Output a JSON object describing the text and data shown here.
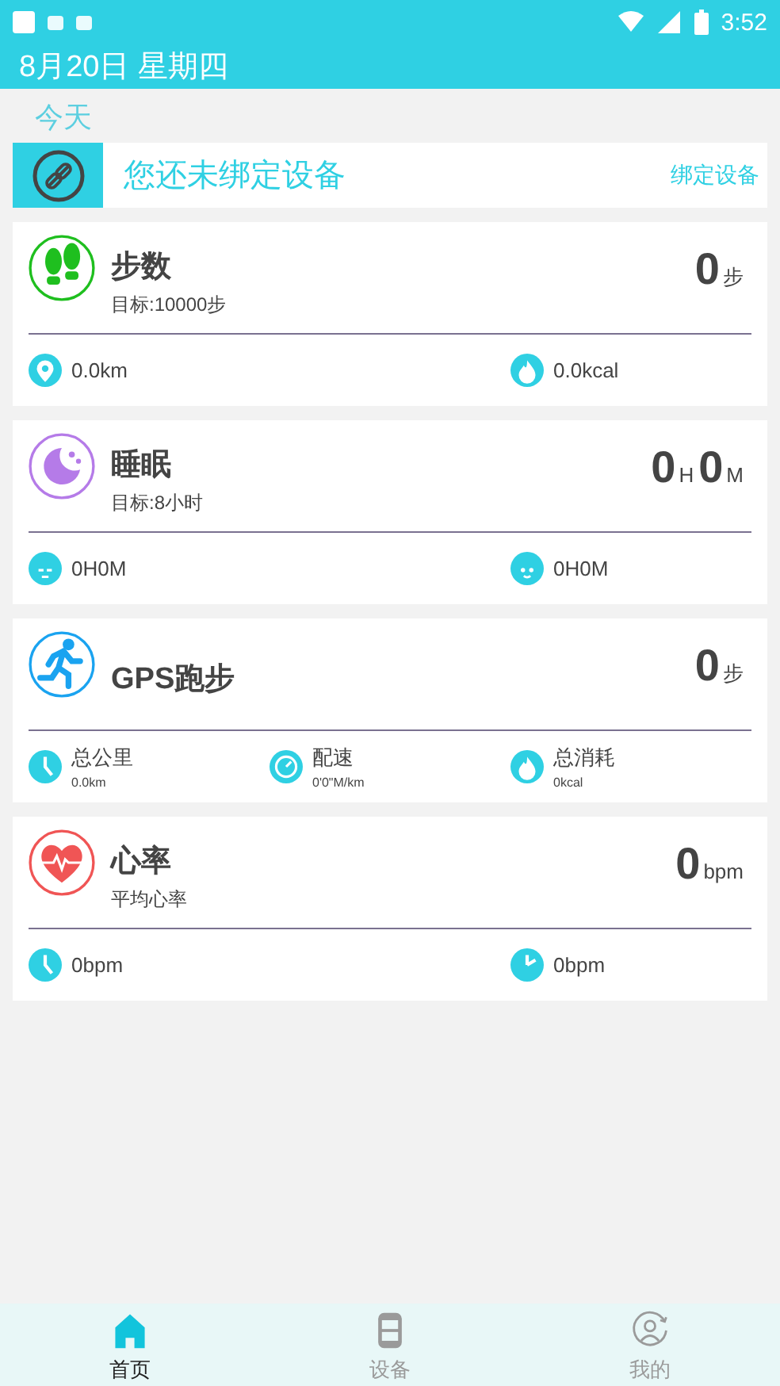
{
  "status_bar": {
    "time": "3:52"
  },
  "header": {
    "title": "8月20日 星期四"
  },
  "section_label": "今天",
  "bind_banner": {
    "message": "您还未绑定设备",
    "action": "绑定设备"
  },
  "cards": [
    {
      "kind": "steps",
      "color": "#1fbf1f",
      "title": "步数",
      "subtitle": "目标:10000步",
      "value": [
        {
          "kind": "number",
          "text": "0"
        },
        {
          "kind": "unit",
          "text": "步"
        }
      ],
      "stats": [
        {
          "kind": "pin",
          "value": "0.0km"
        },
        {
          "kind": "flame",
          "value": "0.0kcal"
        }
      ]
    },
    {
      "kind": "sleep",
      "color": "#b57be8",
      "title": "睡眠",
      "subtitle": "目标:8小时",
      "value": [
        {
          "kind": "number",
          "text": "0"
        },
        {
          "kind": "unit",
          "text": "H"
        },
        {
          "kind": "number",
          "text": "0"
        },
        {
          "kind": "unit",
          "text": "M"
        }
      ],
      "stats": [
        {
          "kind": "sleepy-face",
          "value": "0H0M"
        },
        {
          "kind": "face",
          "value": "0H0M"
        }
      ]
    },
    {
      "kind": "run",
      "color": "#1aa3f0",
      "title": "GPS跑步",
      "value": [
        {
          "kind": "number",
          "text": "0"
        },
        {
          "kind": "unit",
          "text": "步"
        }
      ],
      "stats": [
        {
          "kind": "clock",
          "label": "总公里",
          "value": "0.0km"
        },
        {
          "kind": "gauge",
          "label": "配速",
          "value": "0'0\"M/km"
        },
        {
          "kind": "flame",
          "label": "总消耗",
          "value": "0kcal"
        }
      ]
    },
    {
      "kind": "heart",
      "color": "#f05555",
      "title": "心率",
      "subtitle": "平均心率",
      "value": [
        {
          "kind": "number",
          "text": "0"
        },
        {
          "kind": "unit",
          "text": "bpm"
        }
      ],
      "stats": [
        {
          "kind": "clock",
          "value": "0bpm"
        },
        {
          "kind": "clock-right",
          "value": "0bpm"
        }
      ]
    }
  ],
  "bottom_nav": [
    {
      "kind": "home",
      "label": "首页",
      "selected": true
    },
    {
      "kind": "watch",
      "label": "设备",
      "selected": false
    },
    {
      "kind": "person",
      "label": "我的",
      "selected": false
    }
  ]
}
